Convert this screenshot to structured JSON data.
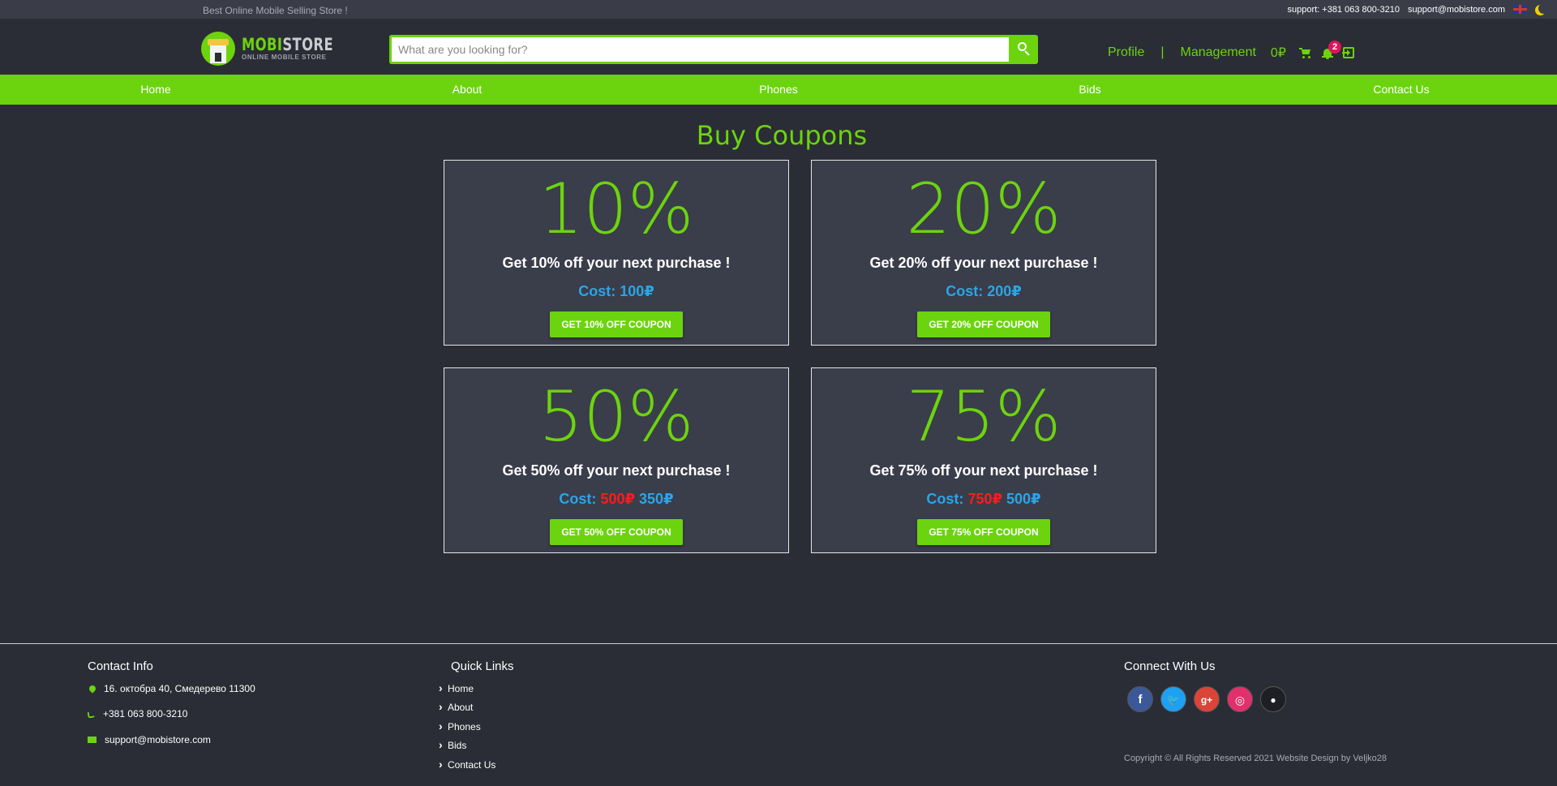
{
  "topbar": {
    "tagline": "Best Online Mobile Selling Store !",
    "support_phone": "support: +381 063 800-3210",
    "support_email": "support@mobistore.com"
  },
  "header": {
    "logo_brand_a": "MOBI",
    "logo_brand_b": "STORE",
    "logo_sub": "ONLINE MOBILE STORE",
    "search_placeholder": "What are you looking for?",
    "profile_label": "Profile",
    "separator": "|",
    "management_label": "Management",
    "balance": "0₽",
    "notification_count": "2"
  },
  "nav": {
    "items": [
      "Home",
      "About",
      "Phones",
      "Bids",
      "Contact Us"
    ]
  },
  "main": {
    "title": "Buy Coupons",
    "cost_label": "Cost:",
    "coupons": [
      {
        "percent": "10%",
        "desc": "Get 10% off your next purchase !",
        "old_price": "",
        "price": "100₽",
        "button": "GET 10% OFF COUPON"
      },
      {
        "percent": "20%",
        "desc": "Get 20% off your next purchase !",
        "old_price": "",
        "price": "200₽",
        "button": "GET 20% OFF COUPON"
      },
      {
        "percent": "50%",
        "desc": "Get 50% off your next purchase !",
        "old_price": "500₽",
        "price": "350₽",
        "button": "GET 50% OFF COUPON"
      },
      {
        "percent": "75%",
        "desc": "Get 75% off your next purchase !",
        "old_price": "750₽",
        "price": "500₽",
        "button": "GET 75% OFF COUPON"
      }
    ]
  },
  "footer": {
    "contact_heading": "Contact Info",
    "address": "16. октобра 40, Смедерево 11300",
    "phone": "+381 063 800-3210",
    "email": "support@mobistore.com",
    "quick_heading": "Quick Links",
    "quick_links": [
      "Home",
      "About",
      "Phones",
      "Bids",
      "Contact Us"
    ],
    "connect_heading": "Connect With Us",
    "socials": [
      {
        "name": "facebook",
        "glyph": "f"
      },
      {
        "name": "twitter",
        "glyph": "🐦"
      },
      {
        "name": "google-plus",
        "glyph": "g+"
      },
      {
        "name": "instagram",
        "glyph": "◎"
      },
      {
        "name": "github",
        "glyph": "●"
      }
    ],
    "copyright": "Copyright © All Rights Reserved 2021 Website Design by Veljko28"
  },
  "colors": {
    "accent": "#6cd40e",
    "background": "#2a2d36",
    "card_bg": "#3a3d4a",
    "price_blue": "#29a6e8",
    "old_price_red": "#ff1b1b",
    "badge": "#e0135d"
  }
}
